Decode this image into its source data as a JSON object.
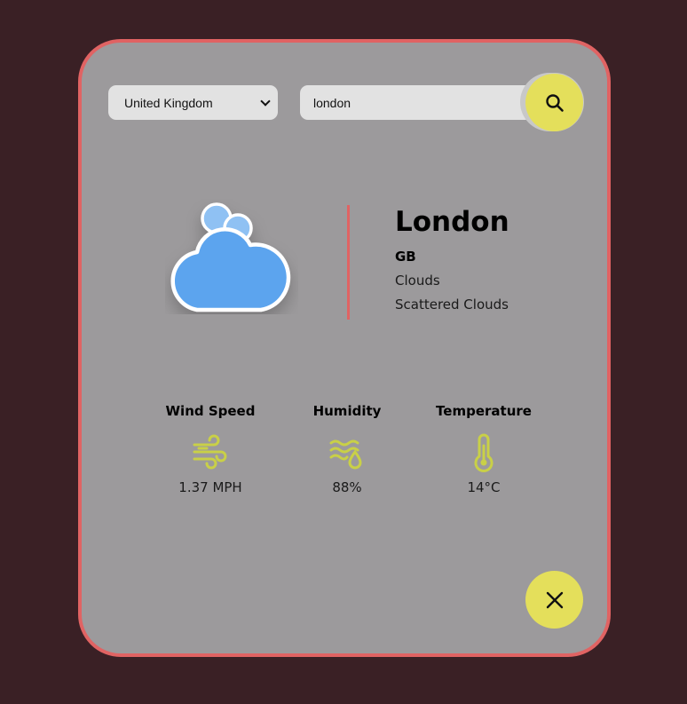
{
  "search": {
    "country_selected": "United Kingdom",
    "city_value": "london"
  },
  "weather": {
    "city": "London",
    "country_code": "GB",
    "main": "Clouds",
    "description": "Scattered Clouds",
    "icon": "scattered-clouds-icon"
  },
  "stats": {
    "wind": {
      "label": "Wind Speed",
      "value": "1.37 MPH",
      "icon": "wind-icon"
    },
    "humidity": {
      "label": "Humidity",
      "value": "88%",
      "icon": "humidity-icon"
    },
    "temperature": {
      "label": "Temperature",
      "value": "14°C",
      "icon": "thermometer-icon"
    }
  },
  "colors": {
    "background": "#3a2025",
    "card": "#9c9a9c",
    "card_border": "#e06363",
    "accent_button": "#e4df5b",
    "stat_icon": "#c9d047",
    "cloud_fill": "#5ba4ee"
  }
}
